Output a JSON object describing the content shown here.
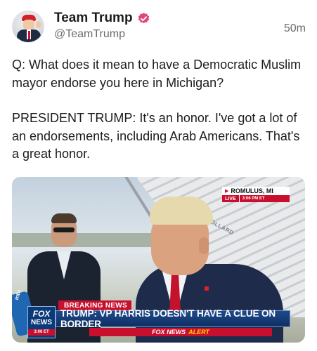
{
  "author": {
    "display_name": "Team Trump",
    "handle": "@TeamTrump",
    "timestamp": "50m",
    "verified": true
  },
  "post": {
    "paragraphs": [
      "Q: What does it mean to have a Democratic Muslim mayor endorse you here in Michigan?",
      "PRESIDENT TRUMP: It's an honor. I've got a lot of an endorsements, including Arab Americans. That's a great honor."
    ]
  },
  "media": {
    "location": "ROMULUS, MI",
    "live_label": "LIVE",
    "live_time": "3:06 PM ET",
    "stairs_text": "HOLLARD",
    "mic_label": "mtu",
    "network_logo": {
      "fox": "FOX",
      "news": "NEWS",
      "time": "3:06 ET"
    },
    "breaking_label": "BREAKING NEWS",
    "headline": "TRUMP: VP HARRIS DOESN'T HAVE A CLUE ON BORDER",
    "alert_brand": "FOX NEWS",
    "alert_word": "ALERT"
  },
  "colors": {
    "verified_badge": "#e0457b",
    "fox_red": "#c8102e",
    "fox_blue": "#0f2f63",
    "alert_yellow": "#ffd200"
  },
  "icons": {
    "verified": "verified-badge-icon"
  }
}
